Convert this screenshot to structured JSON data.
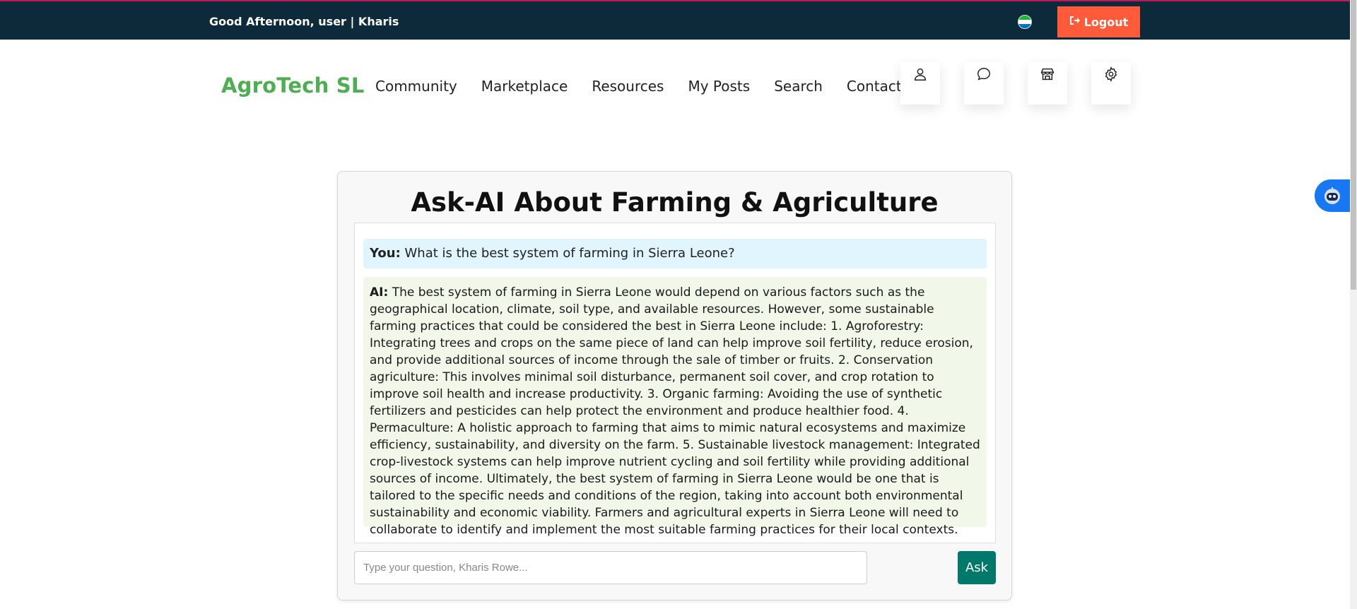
{
  "topbar": {
    "greeting": "Good Afternoon, user | Kharis",
    "logout_label": "Logout"
  },
  "header": {
    "brand": "AgroTech SL",
    "nav": [
      "Community",
      "Marketplace",
      "Resources",
      "My Posts",
      "Search",
      "Contact"
    ],
    "icons": [
      "user-icon",
      "chat-icon",
      "store-icon",
      "settings-icon"
    ]
  },
  "chat": {
    "title": "Ask-AI About Farming & Agriculture",
    "user_label": "You:",
    "user_message": "What is the best system of farming in Sierra Leone?",
    "ai_label": "AI:",
    "ai_message": "The best system of farming in Sierra Leone would depend on various factors such as the geographical location, climate, soil type, and available resources. However, some sustainable farming practices that could be considered the best in Sierra Leone include: 1. Agroforestry: Integrating trees and crops on the same piece of land can help improve soil fertility, reduce erosion, and provide additional sources of income through the sale of timber or fruits. 2. Conservation agriculture: This involves minimal soil disturbance, permanent soil cover, and crop rotation to improve soil health and increase productivity. 3. Organic farming: Avoiding the use of synthetic fertilizers and pesticides can help protect the environment and produce healthier food. 4. Permaculture: A holistic approach to farming that aims to mimic natural ecosystems and maximize efficiency, sustainability, and diversity on the farm. 5. Sustainable livestock management: Integrated crop-livestock systems can help improve nutrient cycling and soil fertility while providing additional sources of income. Ultimately, the best system of farming in Sierra Leone would be one that is tailored to the specific needs and conditions of the region, taking into account both environmental sustainability and economic viability. Farmers and agricultural experts in Sierra Leone will need to collaborate to identify and implement the most suitable farming practices for their local contexts.",
    "input_placeholder": "Type your question, Kharis Rowe...",
    "input_value": "",
    "ask_label": "Ask"
  },
  "colors": {
    "topbar": "#0d2a3a",
    "logout": "#ff5b3a",
    "brand": "#4caf50",
    "ask": "#00796b",
    "user_bubble": "#e1f5fe",
    "ai_bubble": "#f1f8e9",
    "bot_widget": "#1877f2"
  }
}
